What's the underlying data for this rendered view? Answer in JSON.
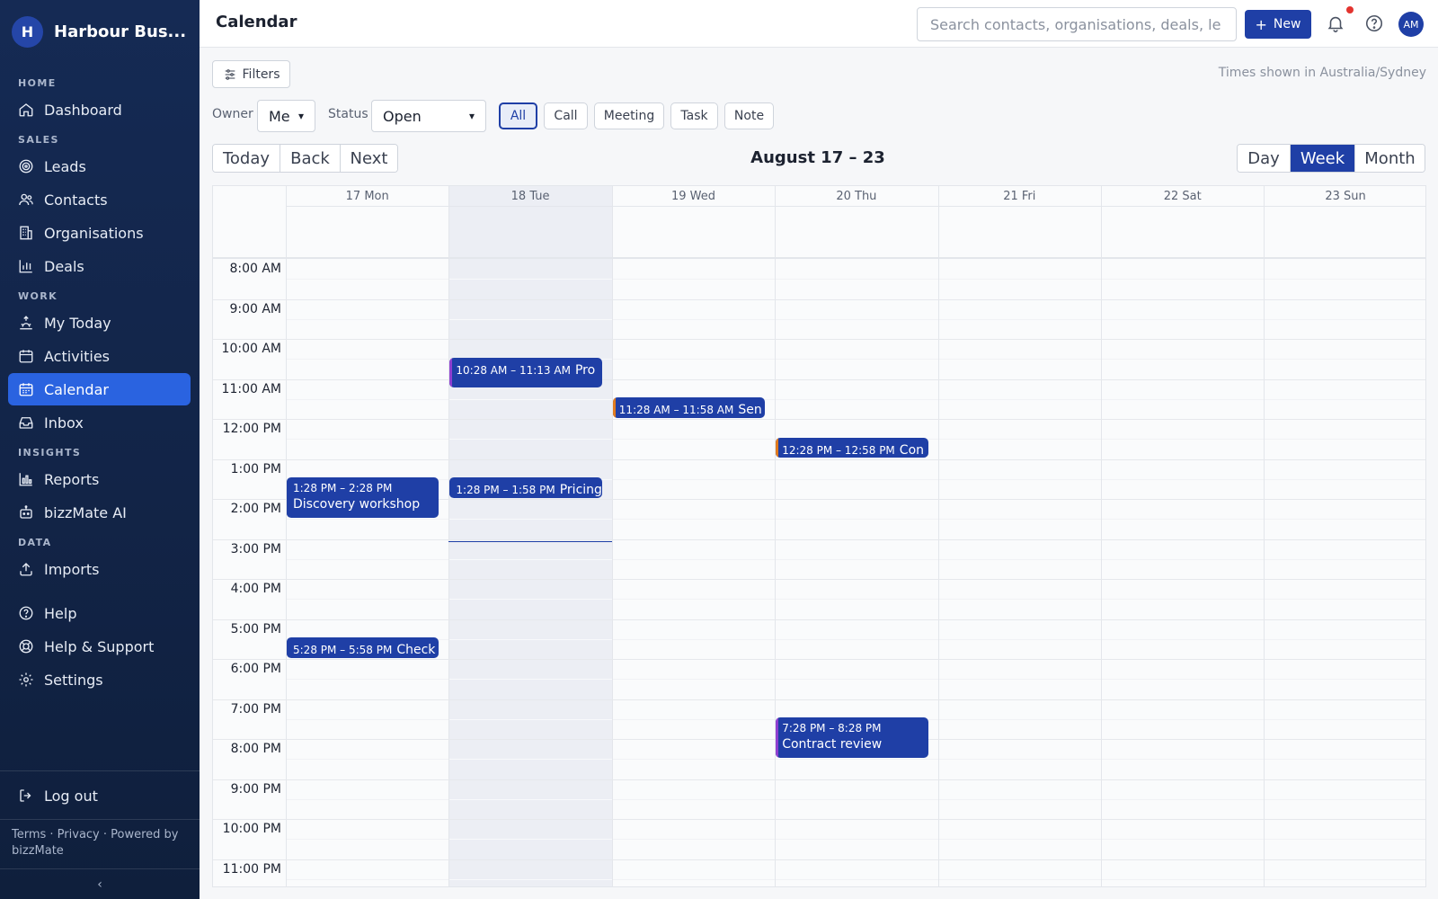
{
  "app": {
    "name": "Harbour Bus...",
    "logo_letter": "H"
  },
  "sidebar": {
    "sections": {
      "home": "HOME",
      "sales": "SALES",
      "work": "WORK",
      "insights": "INSIGHTS",
      "data": "DATA"
    },
    "items": {
      "dashboard": "Dashboard",
      "leads": "Leads",
      "contacts": "Contacts",
      "organisations": "Organisations",
      "deals": "Deals",
      "my_today": "My Today",
      "activities": "Activities",
      "calendar": "Calendar",
      "inbox": "Inbox",
      "reports": "Reports",
      "bizzmate_ai": "bizzMate AI",
      "imports": "Imports",
      "help": "Help",
      "help_support": "Help & Support",
      "settings": "Settings",
      "logout": "Log out"
    },
    "active": "calendar",
    "footer": "Terms · Privacy · Powered by bizzMate",
    "collapse_glyph": "‹"
  },
  "topbar": {
    "title": "Calendar",
    "search_placeholder": "Search contacts, organisations, deals, le",
    "new_label": "New",
    "avatar_initials": "AM"
  },
  "toolbar": {
    "filters_label": "Filters",
    "timezone_note": "Times shown in Australia/Sydney",
    "owner_label": "Owner",
    "owner_value": "Me",
    "status_label": "Status",
    "status_value": "Open",
    "type_chips": [
      "All",
      "Call",
      "Meeting",
      "Task",
      "Note"
    ],
    "active_chip": "All",
    "nav_buttons": [
      "Today",
      "Back",
      "Next"
    ],
    "range_title": "August 17 – 23",
    "views": [
      "Day",
      "Week",
      "Month"
    ],
    "active_view": "Week"
  },
  "calendar": {
    "days": [
      "17 Mon",
      "18 Tue",
      "19 Wed",
      "20 Thu",
      "21 Fri",
      "22 Sat",
      "23 Sun"
    ],
    "today_index": 1,
    "hours": [
      "8:00 AM",
      "9:00 AM",
      "10:00 AM",
      "11:00 AM",
      "12:00 PM",
      "1:00 PM",
      "2:00 PM",
      "3:00 PM",
      "4:00 PM",
      "5:00 PM",
      "6:00 PM",
      "7:00 PM",
      "8:00 PM",
      "9:00 PM",
      "10:00 PM",
      "11:00 PM"
    ],
    "first_hour": 8,
    "now_hour": 15.05,
    "events": [
      {
        "day": 1,
        "start": 10.467,
        "end": 11.217,
        "time": "10:28 AM – 11:13 AM",
        "title": "Pro",
        "accent": "#8e3fd0",
        "layout": "inline"
      },
      {
        "day": 2,
        "start": 11.467,
        "end": 11.967,
        "time": "11:28 AM – 11:58 AM",
        "title": "Sen",
        "accent": "#e07b1f",
        "layout": "inline"
      },
      {
        "day": 3,
        "start": 12.467,
        "end": 12.967,
        "time": "12:28 PM – 12:58 PM",
        "title": "Con",
        "accent": "#e07b1f",
        "layout": "inline"
      },
      {
        "day": 0,
        "start": 13.467,
        "end": 14.467,
        "time": "1:28 PM – 2:28 PM",
        "title": "Discovery workshop",
        "accent": "#1f3fa6",
        "layout": "stacked"
      },
      {
        "day": 1,
        "start": 13.467,
        "end": 13.967,
        "time": "1:28 PM – 1:58 PM",
        "title": "Pricing",
        "accent": "#1f3fa6",
        "layout": "inline"
      },
      {
        "day": 0,
        "start": 17.467,
        "end": 17.967,
        "time": "5:28 PM – 5:58 PM",
        "title": "Check",
        "accent": "#1f3fa6",
        "layout": "inline"
      },
      {
        "day": 3,
        "start": 19.467,
        "end": 20.467,
        "time": "7:28 PM – 8:28 PM",
        "title": "Contract review",
        "accent": "#8e3fd0",
        "layout": "stacked"
      }
    ]
  },
  "colors": {
    "primary": "#1f3fa6",
    "active_nav": "#2a63e0",
    "notification_dot": "#e3342f"
  },
  "icons": {
    "dashboard": "home-icon",
    "leads": "target-icon",
    "contacts": "users-icon",
    "organisations": "building-icon",
    "deals": "bar-chart-icon",
    "my_today": "sunrise-icon",
    "activities": "calendar-icon",
    "calendar": "calendar-icon",
    "inbox": "inbox-icon",
    "reports": "chart-icon",
    "bizzmate_ai": "robot-icon",
    "imports": "upload-icon",
    "help": "help-circle-icon",
    "help_support": "lifebuoy-icon",
    "settings": "gear-icon",
    "logout": "logout-icon"
  }
}
